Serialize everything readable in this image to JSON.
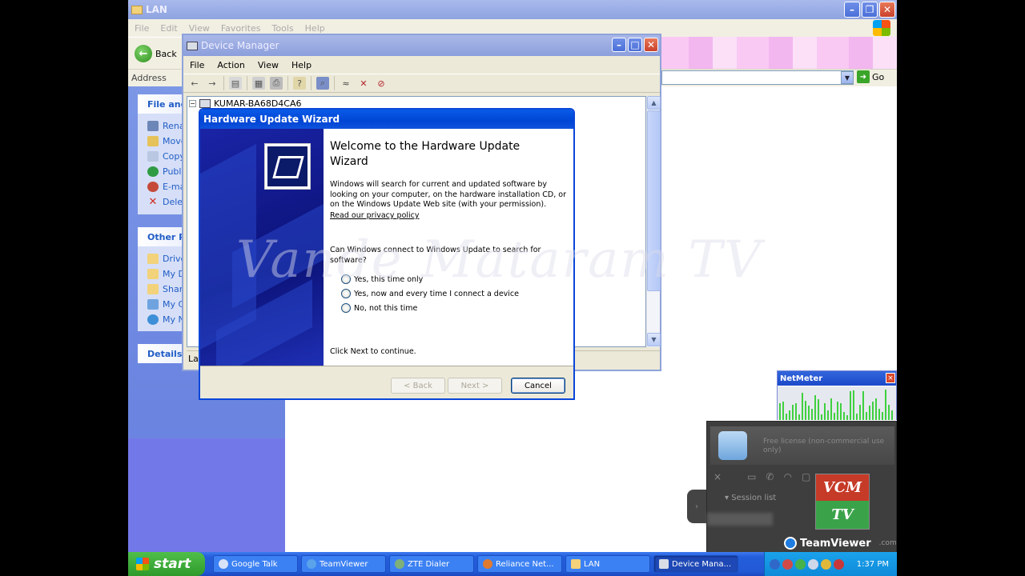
{
  "explorer": {
    "title": "LAN",
    "menu": [
      "File",
      "Edit",
      "View",
      "Favorites",
      "Tools",
      "Help"
    ],
    "back_label": "Back",
    "address_label": "Address",
    "go_label": "Go",
    "file_tasks": {
      "header": "File and",
      "items": [
        "Rena",
        "Move",
        "Copy",
        "Publi",
        "E-ma",
        "Delet"
      ]
    },
    "other_places": {
      "header": "Other Pl",
      "items": [
        "Drive",
        "My D",
        "Shar",
        "My C",
        "My N"
      ]
    },
    "details_header": "Details"
  },
  "device_manager": {
    "title": "Device Manager",
    "menu": [
      "File",
      "Action",
      "View",
      "Help"
    ],
    "tree_root": "KUMAR-BA68D4CA6",
    "status_text": "Lau"
  },
  "wizard": {
    "title": "Hardware Update Wizard",
    "heading": "Welcome to the Hardware Update Wizard",
    "description": "Windows will search for current and updated software by looking on your computer, on the hardware installation CD, or on the Windows Update Web site (with your permission).",
    "privacy_link": "Read our privacy policy",
    "question": "Can Windows connect to Windows Update to search for software?",
    "options": [
      "Yes, this time only",
      "Yes, now and every time I connect a device",
      "No, not this time"
    ],
    "continue_text": "Click Next to continue.",
    "buttons": {
      "back": "< Back",
      "next": "Next >",
      "cancel": "Cancel"
    }
  },
  "watermark": "Vande Mataram TV",
  "netmeter": {
    "title": "NetMeter",
    "close": "×"
  },
  "teamviewer": {
    "note": "Free license (non-commercial use only)",
    "session_list": "Session list",
    "brand": "TeamViewer",
    "brand_suffix": ".com",
    "close": "×"
  },
  "vcm_logo": {
    "top": "VCM",
    "bottom": "TV"
  },
  "taskbar": {
    "start_label": "start",
    "tasks": [
      "Google Talk",
      "TeamViewer",
      "ZTE Dialer",
      "Reliance Net...",
      "LAN",
      "Device Mana..."
    ],
    "active_task_index": 5,
    "clock": "1:37 PM"
  },
  "colors": {
    "wizard_title": "#0045d4",
    "taskbar": "#245edb",
    "start": "#2e9a2b"
  }
}
